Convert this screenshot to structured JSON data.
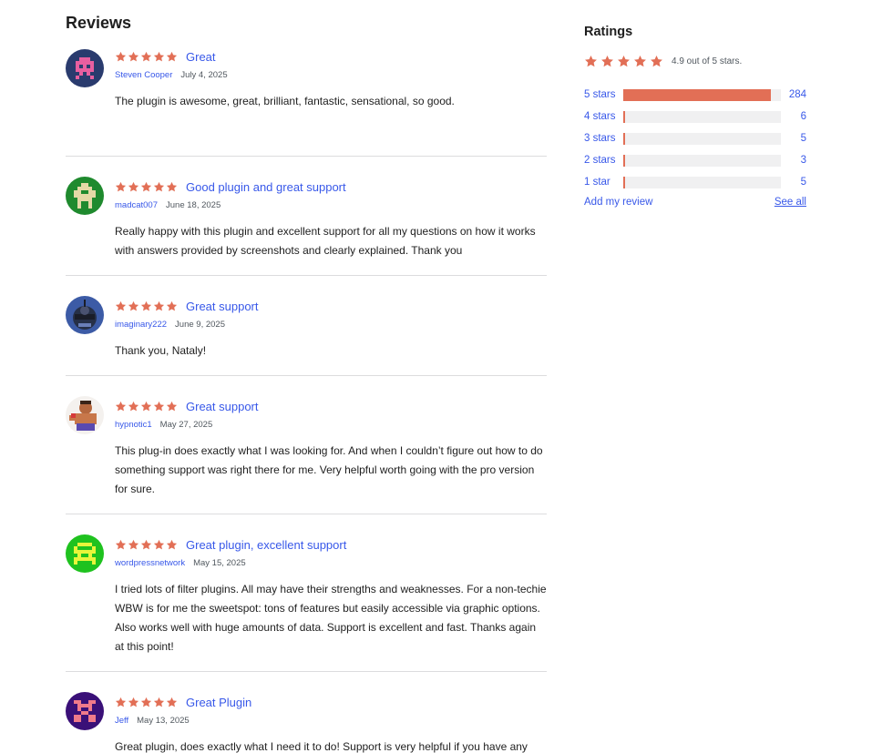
{
  "reviews_heading": "Reviews",
  "star_color": "#e26f56",
  "link_color": "#3858e9",
  "reviews": [
    {
      "rating": 5,
      "title": "Great",
      "author": "Steven Cooper",
      "date": "July 4, 2025",
      "body": "The plugin is awesome, great, brilliant, fantastic, sensational, so good."
    },
    {
      "rating": 5,
      "title": "Good plugin and great support",
      "author": "madcat007",
      "date": "June 18, 2025",
      "body": "Really happy with this plugin and excellent support for all my questions on how it works with answers provided by screenshots and clearly explained. Thank you"
    },
    {
      "rating": 5,
      "title": "Great support",
      "author": "imaginary222",
      "date": "June 9, 2025",
      "body": "Thank you, Nataly!"
    },
    {
      "rating": 5,
      "title": "Great support",
      "author": "hypnotic1",
      "date": "May 27, 2025",
      "body": "This plug-in does exactly what I was looking for. And when I couldn’t figure out how to do something support was right there for me. Very helpful worth going with the pro version for sure."
    },
    {
      "rating": 5,
      "title": "Great plugin, excellent support",
      "author": "wordpressnetwork",
      "date": "May 15, 2025",
      "body": "I tried lots of filter plugins. All may have their strengths and weaknesses. For a non-techie WBW is for me the sweetspot: tons of features but easily accessible via graphic options. Also works well with huge amounts of data. Support is excellent and fast. Thanks again at this point!"
    },
    {
      "rating": 5,
      "title": "Great Plugin",
      "author": "Jeff",
      "date": "May 13, 2025",
      "body": "Great plugin, does exactly what I need it to do! Support is very helpful if you have any questions!"
    }
  ],
  "ratings": {
    "heading": "Ratings",
    "average": 4.9,
    "summary": "4.9 out of 5 stars.",
    "rows": [
      {
        "label": "5 stars",
        "count": "284",
        "fraction": 0.9353
      },
      {
        "label": "4 stars",
        "count": "6",
        "fraction": 0.012
      },
      {
        "label": "3 stars",
        "count": "5",
        "fraction": 0.012
      },
      {
        "label": "2 stars",
        "count": "3",
        "fraction": 0.012
      },
      {
        "label": "1 star",
        "count": "5",
        "fraction": 0.012
      }
    ],
    "add_review": "Add my review",
    "see_all": "See all"
  }
}
